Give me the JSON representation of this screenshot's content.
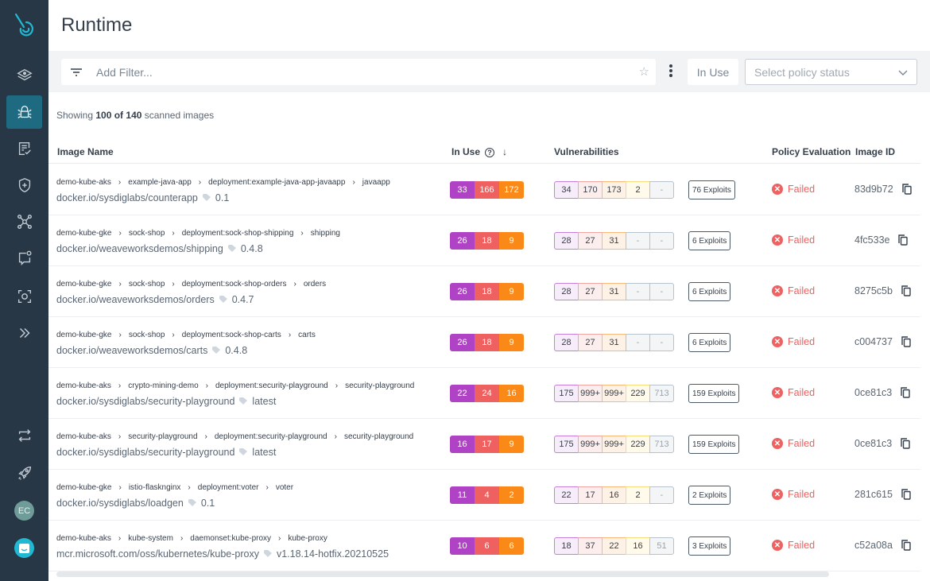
{
  "app": {
    "page_title": "Runtime",
    "colors": {
      "sidebar": "#273746",
      "active": "#1e6a80",
      "critical": "#b043c5",
      "high": "#ee6160",
      "medium": "#fb8917",
      "failed": "#ee6160"
    }
  },
  "sidebar": {
    "items": [
      {
        "name": "layers",
        "icon": "layers-icon"
      },
      {
        "name": "vulnerabilities",
        "icon": "bug-icon",
        "active": true
      },
      {
        "name": "compliance",
        "icon": "checklist-icon"
      },
      {
        "name": "policies",
        "icon": "shield-plus-icon"
      },
      {
        "name": "network",
        "icon": "network-icon"
      },
      {
        "name": "events",
        "icon": "chat-alert-icon"
      },
      {
        "name": "capture",
        "icon": "capture-icon"
      },
      {
        "name": "expand",
        "icon": "double-chevron-right-icon"
      },
      {
        "name": "integrations",
        "icon": "sync-icon"
      },
      {
        "name": "get-started",
        "icon": "rocket-icon"
      }
    ],
    "avatar_initials": "EC"
  },
  "filter": {
    "placeholder": "Add Filter...",
    "in_use_label": "In Use",
    "policy_placeholder": "Select policy status"
  },
  "summary": {
    "prefix": "Showing ",
    "count": "100 of 140",
    "suffix": " scanned images"
  },
  "table": {
    "columns": {
      "image_name": "Image Name",
      "in_use": "In Use",
      "vulnerabilities": "Vulnerabilities",
      "policy": "Policy Evaluation",
      "image_id": "Image ID"
    },
    "rows": [
      {
        "crumbs": [
          "demo-kube-aks",
          "example-java-app",
          "deployment:example-java-app-javaapp",
          "javaapp"
        ],
        "image": "docker.io/sysdiglabs/counterapp",
        "tag": "0.1",
        "in_use": [
          "33",
          "166",
          "172"
        ],
        "vulns": [
          "34",
          "170",
          "173",
          "2",
          "-"
        ],
        "exploits": "76 Exploits",
        "policy": "Failed",
        "id": "83d9b72"
      },
      {
        "crumbs": [
          "demo-kube-gke",
          "sock-shop",
          "deployment:sock-shop-shipping",
          "shipping"
        ],
        "image": "docker.io/weaveworksdemos/shipping",
        "tag": "0.4.8",
        "in_use": [
          "26",
          "18",
          "9"
        ],
        "vulns": [
          "28",
          "27",
          "31",
          "-",
          "-"
        ],
        "exploits": "6 Exploits",
        "policy": "Failed",
        "id": "4fc533e"
      },
      {
        "crumbs": [
          "demo-kube-gke",
          "sock-shop",
          "deployment:sock-shop-orders",
          "orders"
        ],
        "image": "docker.io/weaveworksdemos/orders",
        "tag": "0.4.7",
        "in_use": [
          "26",
          "18",
          "9"
        ],
        "vulns": [
          "28",
          "27",
          "31",
          "-",
          "-"
        ],
        "exploits": "6 Exploits",
        "policy": "Failed",
        "id": "8275c5b"
      },
      {
        "crumbs": [
          "demo-kube-gke",
          "sock-shop",
          "deployment:sock-shop-carts",
          "carts"
        ],
        "image": "docker.io/weaveworksdemos/carts",
        "tag": "0.4.8",
        "in_use": [
          "26",
          "18",
          "9"
        ],
        "vulns": [
          "28",
          "27",
          "31",
          "-",
          "-"
        ],
        "exploits": "6 Exploits",
        "policy": "Failed",
        "id": "c004737"
      },
      {
        "crumbs": [
          "demo-kube-aks",
          "crypto-mining-demo",
          "deployment:security-playground",
          "security-playground"
        ],
        "image": "docker.io/sysdiglabs/security-playground",
        "tag": "latest",
        "in_use": [
          "22",
          "24",
          "16"
        ],
        "vulns": [
          "175",
          "999+",
          "999+",
          "229",
          "713"
        ],
        "exploits": "159 Exploits",
        "policy": "Failed",
        "id": "0ce81c3"
      },
      {
        "crumbs": [
          "demo-kube-aks",
          "security-playground",
          "deployment:security-playground",
          "security-playground"
        ],
        "image": "docker.io/sysdiglabs/security-playground",
        "tag": "latest",
        "in_use": [
          "16",
          "17",
          "9"
        ],
        "vulns": [
          "175",
          "999+",
          "999+",
          "229",
          "713"
        ],
        "exploits": "159 Exploits",
        "policy": "Failed",
        "id": "0ce81c3"
      },
      {
        "crumbs": [
          "demo-kube-gke",
          "istio-flasknginx",
          "deployment:voter",
          "voter"
        ],
        "image": "docker.io/sysdiglabs/loadgen",
        "tag": "0.1",
        "in_use": [
          "11",
          "4",
          "2"
        ],
        "vulns": [
          "22",
          "17",
          "16",
          "2",
          "-"
        ],
        "exploits": "2 Exploits",
        "policy": "Failed",
        "id": "281c615"
      },
      {
        "crumbs": [
          "demo-kube-aks",
          "kube-system",
          "daemonset:kube-proxy",
          "kube-proxy"
        ],
        "image": "mcr.microsoft.com/oss/kubernetes/kube-proxy",
        "tag": "v1.18.14-hotfix.20210525",
        "in_use": [
          "10",
          "6",
          "6"
        ],
        "vulns": [
          "18",
          "37",
          "22",
          "16",
          "51"
        ],
        "exploits": "3 Exploits",
        "policy": "Failed",
        "id": "c52a08a"
      }
    ]
  }
}
